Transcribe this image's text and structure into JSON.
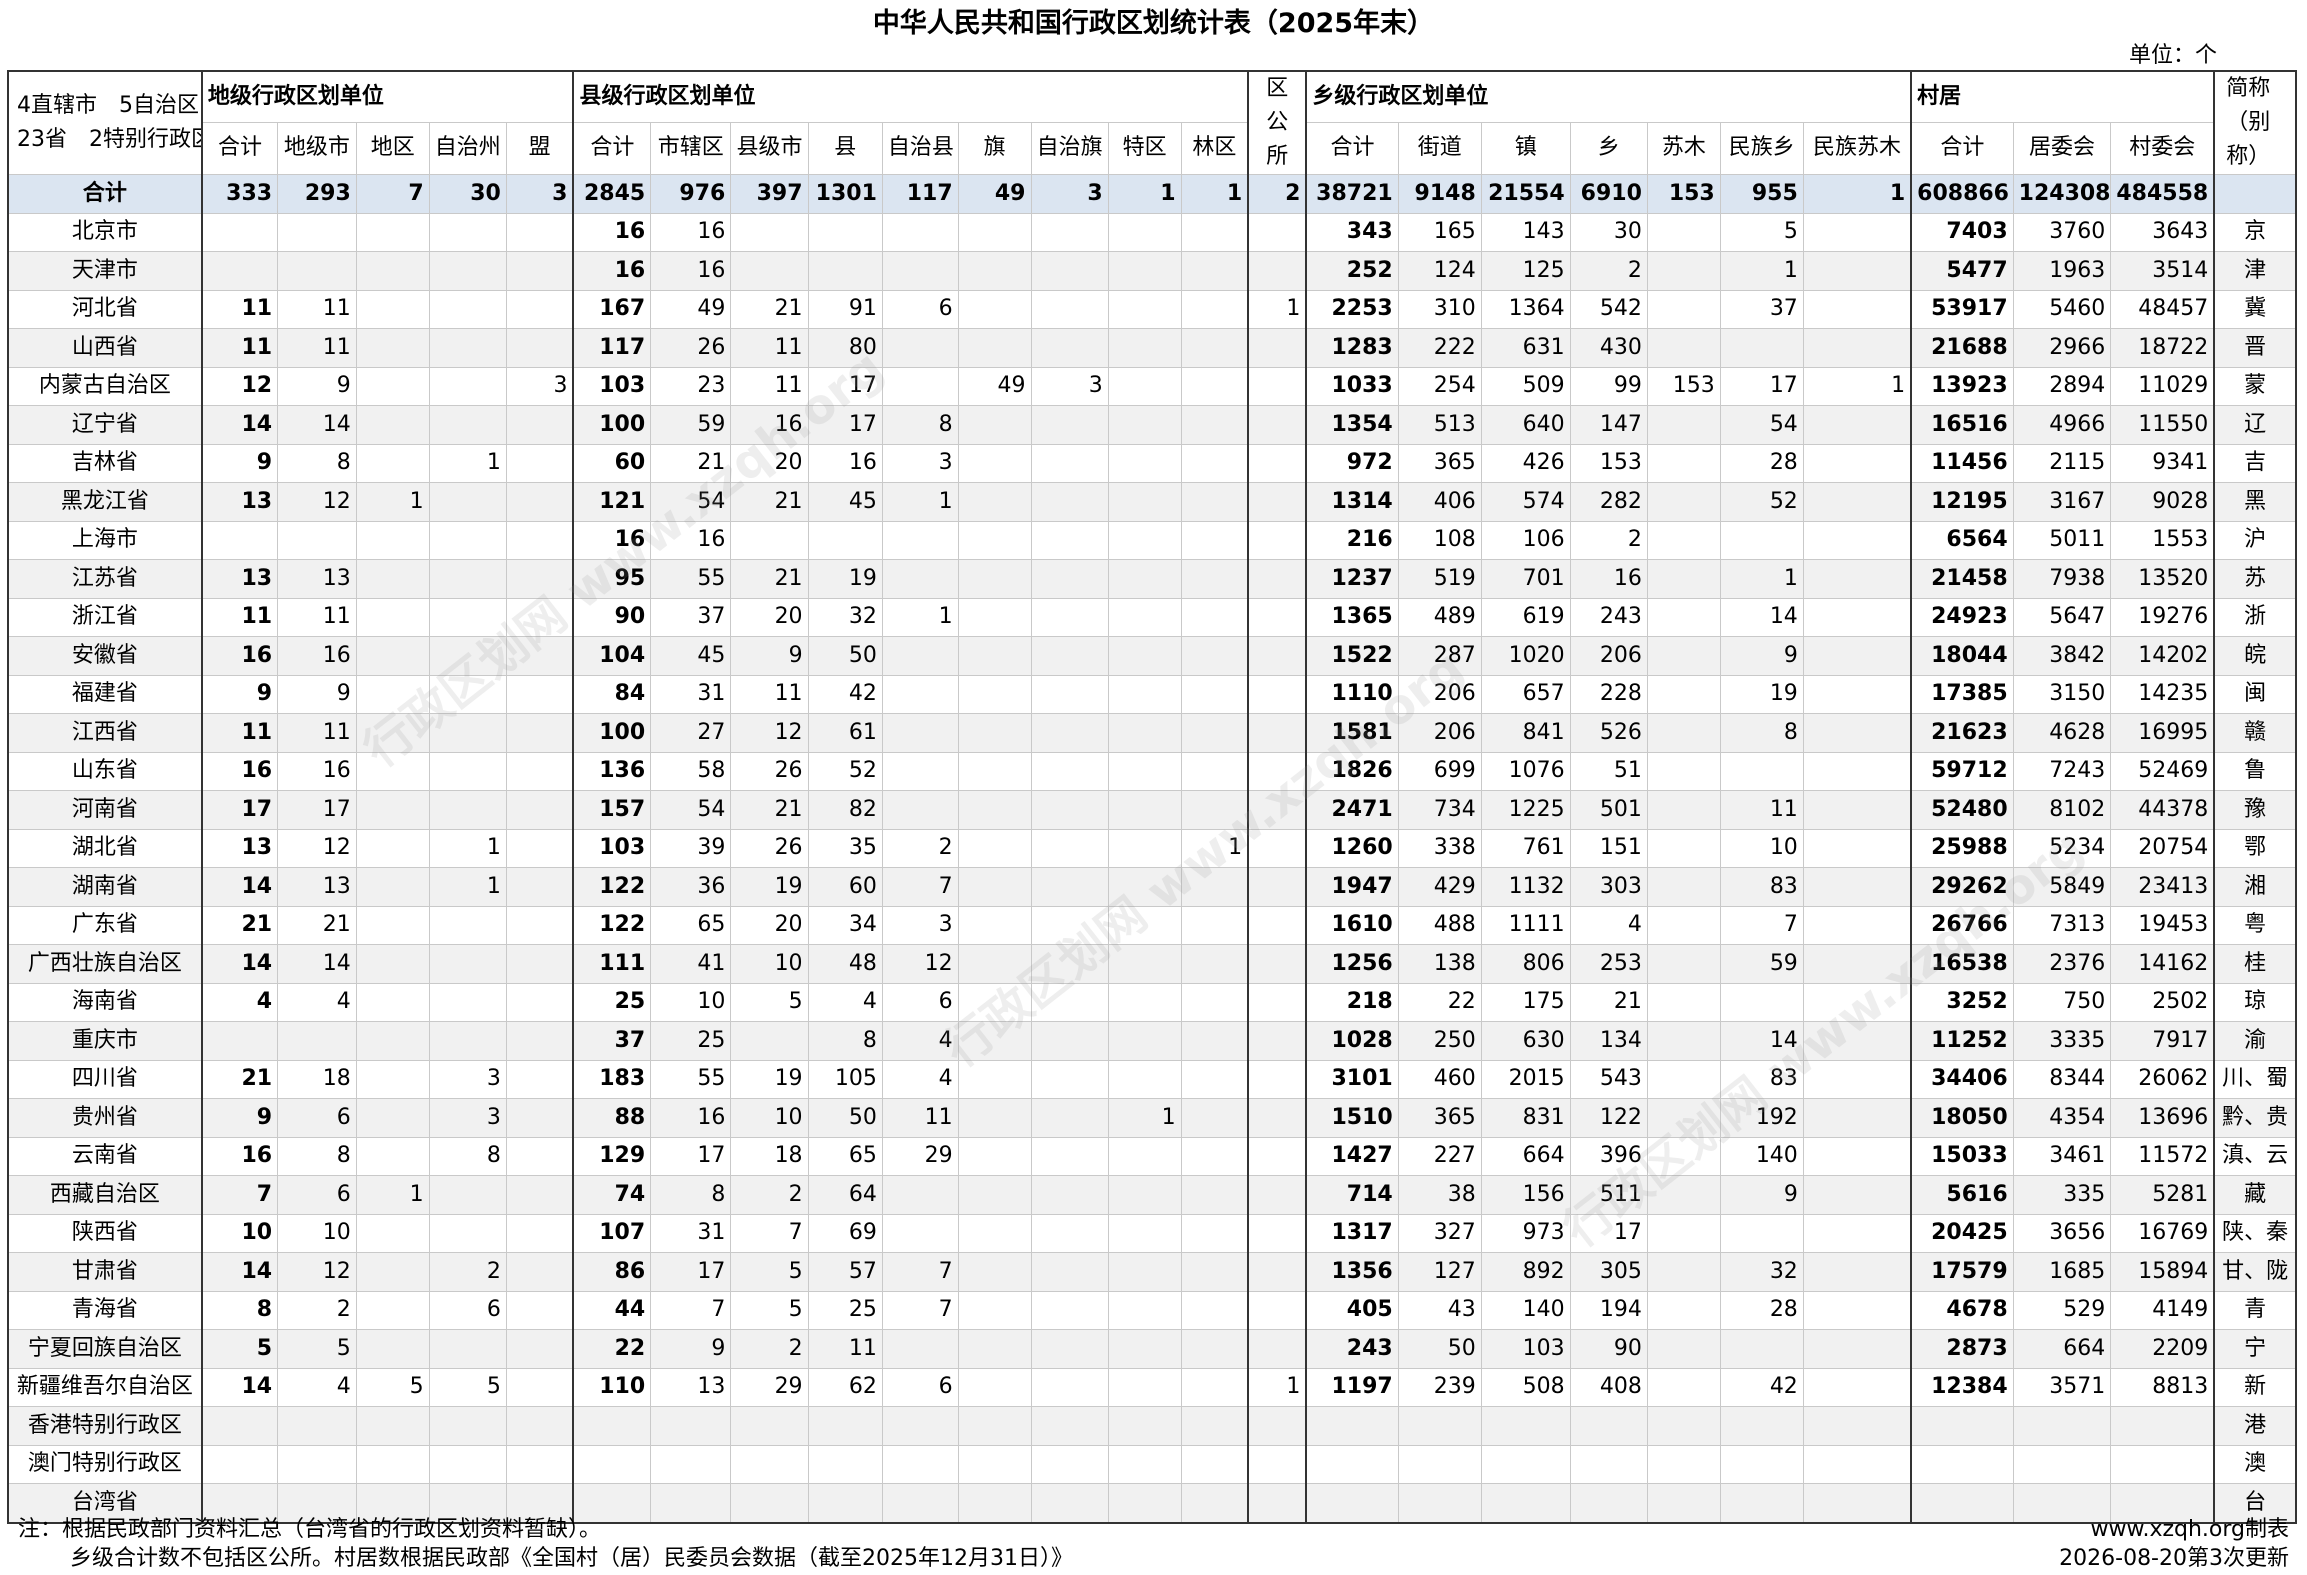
{
  "title": "中华人民共和国行政区划统计表（2025年末）",
  "unit": "单位：个",
  "corner": {
    "line1": "4直辖市　5自治区",
    "line2": "23省　2特别行政区"
  },
  "groups": {
    "prefecture": "地级行政区划单位",
    "county": "县级行政区划单位",
    "district_office": "区公所",
    "township": "乡级行政区划单位",
    "village": "村居",
    "abbr": "简称（别称）"
  },
  "subheaders": {
    "prefecture": [
      "合计",
      "地级市",
      "地区",
      "自治州",
      "盟"
    ],
    "county": [
      "合计",
      "市辖区",
      "县级市",
      "县",
      "自治县",
      "旗",
      "自治旗",
      "特区",
      "林区"
    ],
    "township": [
      "合计",
      "街道",
      "镇",
      "乡",
      "苏木",
      "民族乡",
      "民族苏木"
    ],
    "village": [
      "合计",
      "居委会",
      "村委会"
    ]
  },
  "rows": [
    {
      "name": "合计",
      "p": [
        "333",
        "293",
        "7",
        "30",
        "3"
      ],
      "c": [
        "2845",
        "976",
        "397",
        "1301",
        "117",
        "49",
        "3",
        "1",
        "1"
      ],
      "q": "2",
      "t": [
        "38721",
        "9148",
        "21554",
        "6910",
        "153",
        "955",
        "1"
      ],
      "v": [
        "608866",
        "124308",
        "484558"
      ],
      "abbr": ""
    },
    {
      "name": "北京市",
      "p": [
        "",
        "",
        "",
        "",
        ""
      ],
      "c": [
        "16",
        "16",
        "",
        "",
        "",
        "",
        "",
        "",
        ""
      ],
      "q": "",
      "t": [
        "343",
        "165",
        "143",
        "30",
        "",
        "5",
        ""
      ],
      "v": [
        "7403",
        "3760",
        "3643"
      ],
      "abbr": "京"
    },
    {
      "name": "天津市",
      "p": [
        "",
        "",
        "",
        "",
        ""
      ],
      "c": [
        "16",
        "16",
        "",
        "",
        "",
        "",
        "",
        "",
        ""
      ],
      "q": "",
      "t": [
        "252",
        "124",
        "125",
        "2",
        "",
        "1",
        ""
      ],
      "v": [
        "5477",
        "1963",
        "3514"
      ],
      "abbr": "津"
    },
    {
      "name": "河北省",
      "p": [
        "11",
        "11",
        "",
        "",
        ""
      ],
      "c": [
        "167",
        "49",
        "21",
        "91",
        "6",
        "",
        "",
        "",
        ""
      ],
      "q": "1",
      "t": [
        "2253",
        "310",
        "1364",
        "542",
        "",
        "37",
        ""
      ],
      "v": [
        "53917",
        "5460",
        "48457"
      ],
      "abbr": "冀"
    },
    {
      "name": "山西省",
      "p": [
        "11",
        "11",
        "",
        "",
        ""
      ],
      "c": [
        "117",
        "26",
        "11",
        "80",
        "",
        "",
        "",
        "",
        ""
      ],
      "q": "",
      "t": [
        "1283",
        "222",
        "631",
        "430",
        "",
        "",
        ""
      ],
      "v": [
        "21688",
        "2966",
        "18722"
      ],
      "abbr": "晋"
    },
    {
      "name": "内蒙古自治区",
      "p": [
        "12",
        "9",
        "",
        "",
        "3"
      ],
      "c": [
        "103",
        "23",
        "11",
        "17",
        "",
        "49",
        "3",
        "",
        ""
      ],
      "q": "",
      "t": [
        "1033",
        "254",
        "509",
        "99",
        "153",
        "17",
        "1"
      ],
      "v": [
        "13923",
        "2894",
        "11029"
      ],
      "abbr": "蒙"
    },
    {
      "name": "辽宁省",
      "p": [
        "14",
        "14",
        "",
        "",
        ""
      ],
      "c": [
        "100",
        "59",
        "16",
        "17",
        "8",
        "",
        "",
        "",
        ""
      ],
      "q": "",
      "t": [
        "1354",
        "513",
        "640",
        "147",
        "",
        "54",
        ""
      ],
      "v": [
        "16516",
        "4966",
        "11550"
      ],
      "abbr": "辽"
    },
    {
      "name": "吉林省",
      "p": [
        "9",
        "8",
        "",
        "1",
        ""
      ],
      "c": [
        "60",
        "21",
        "20",
        "16",
        "3",
        "",
        "",
        "",
        ""
      ],
      "q": "",
      "t": [
        "972",
        "365",
        "426",
        "153",
        "",
        "28",
        ""
      ],
      "v": [
        "11456",
        "2115",
        "9341"
      ],
      "abbr": "吉"
    },
    {
      "name": "黑龙江省",
      "p": [
        "13",
        "12",
        "1",
        "",
        ""
      ],
      "c": [
        "121",
        "54",
        "21",
        "45",
        "1",
        "",
        "",
        "",
        ""
      ],
      "q": "",
      "t": [
        "1314",
        "406",
        "574",
        "282",
        "",
        "52",
        ""
      ],
      "v": [
        "12195",
        "3167",
        "9028"
      ],
      "abbr": "黑"
    },
    {
      "name": "上海市",
      "p": [
        "",
        "",
        "",
        "",
        ""
      ],
      "c": [
        "16",
        "16",
        "",
        "",
        "",
        "",
        "",
        "",
        ""
      ],
      "q": "",
      "t": [
        "216",
        "108",
        "106",
        "2",
        "",
        "",
        ""
      ],
      "v": [
        "6564",
        "5011",
        "1553"
      ],
      "abbr": "沪"
    },
    {
      "name": "江苏省",
      "p": [
        "13",
        "13",
        "",
        "",
        ""
      ],
      "c": [
        "95",
        "55",
        "21",
        "19",
        "",
        "",
        "",
        "",
        ""
      ],
      "q": "",
      "t": [
        "1237",
        "519",
        "701",
        "16",
        "",
        "1",
        ""
      ],
      "v": [
        "21458",
        "7938",
        "13520"
      ],
      "abbr": "苏"
    },
    {
      "name": "浙江省",
      "p": [
        "11",
        "11",
        "",
        "",
        ""
      ],
      "c": [
        "90",
        "37",
        "20",
        "32",
        "1",
        "",
        "",
        "",
        ""
      ],
      "q": "",
      "t": [
        "1365",
        "489",
        "619",
        "243",
        "",
        "14",
        ""
      ],
      "v": [
        "24923",
        "5647",
        "19276"
      ],
      "abbr": "浙"
    },
    {
      "name": "安徽省",
      "p": [
        "16",
        "16",
        "",
        "",
        ""
      ],
      "c": [
        "104",
        "45",
        "9",
        "50",
        "",
        "",
        "",
        "",
        ""
      ],
      "q": "",
      "t": [
        "1522",
        "287",
        "1020",
        "206",
        "",
        "9",
        ""
      ],
      "v": [
        "18044",
        "3842",
        "14202"
      ],
      "abbr": "皖"
    },
    {
      "name": "福建省",
      "p": [
        "9",
        "9",
        "",
        "",
        ""
      ],
      "c": [
        "84",
        "31",
        "11",
        "42",
        "",
        "",
        "",
        "",
        ""
      ],
      "q": "",
      "t": [
        "1110",
        "206",
        "657",
        "228",
        "",
        "19",
        ""
      ],
      "v": [
        "17385",
        "3150",
        "14235"
      ],
      "abbr": "闽"
    },
    {
      "name": "江西省",
      "p": [
        "11",
        "11",
        "",
        "",
        ""
      ],
      "c": [
        "100",
        "27",
        "12",
        "61",
        "",
        "",
        "",
        "",
        ""
      ],
      "q": "",
      "t": [
        "1581",
        "206",
        "841",
        "526",
        "",
        "8",
        ""
      ],
      "v": [
        "21623",
        "4628",
        "16995"
      ],
      "abbr": "赣"
    },
    {
      "name": "山东省",
      "p": [
        "16",
        "16",
        "",
        "",
        ""
      ],
      "c": [
        "136",
        "58",
        "26",
        "52",
        "",
        "",
        "",
        "",
        ""
      ],
      "q": "",
      "t": [
        "1826",
        "699",
        "1076",
        "51",
        "",
        "",
        ""
      ],
      "v": [
        "59712",
        "7243",
        "52469"
      ],
      "abbr": "鲁"
    },
    {
      "name": "河南省",
      "p": [
        "17",
        "17",
        "",
        "",
        ""
      ],
      "c": [
        "157",
        "54",
        "21",
        "82",
        "",
        "",
        "",
        "",
        ""
      ],
      "q": "",
      "t": [
        "2471",
        "734",
        "1225",
        "501",
        "",
        "11",
        ""
      ],
      "v": [
        "52480",
        "8102",
        "44378"
      ],
      "abbr": "豫"
    },
    {
      "name": "湖北省",
      "p": [
        "13",
        "12",
        "",
        "1",
        ""
      ],
      "c": [
        "103",
        "39",
        "26",
        "35",
        "2",
        "",
        "",
        "",
        "1"
      ],
      "q": "",
      "t": [
        "1260",
        "338",
        "761",
        "151",
        "",
        "10",
        ""
      ],
      "v": [
        "25988",
        "5234",
        "20754"
      ],
      "abbr": "鄂"
    },
    {
      "name": "湖南省",
      "p": [
        "14",
        "13",
        "",
        "1",
        ""
      ],
      "c": [
        "122",
        "36",
        "19",
        "60",
        "7",
        "",
        "",
        "",
        ""
      ],
      "q": "",
      "t": [
        "1947",
        "429",
        "1132",
        "303",
        "",
        "83",
        ""
      ],
      "v": [
        "29262",
        "5849",
        "23413"
      ],
      "abbr": "湘"
    },
    {
      "name": "广东省",
      "p": [
        "21",
        "21",
        "",
        "",
        ""
      ],
      "c": [
        "122",
        "65",
        "20",
        "34",
        "3",
        "",
        "",
        "",
        ""
      ],
      "q": "",
      "t": [
        "1610",
        "488",
        "1111",
        "4",
        "",
        "7",
        ""
      ],
      "v": [
        "26766",
        "7313",
        "19453"
      ],
      "abbr": "粤"
    },
    {
      "name": "广西壮族自治区",
      "p": [
        "14",
        "14",
        "",
        "",
        ""
      ],
      "c": [
        "111",
        "41",
        "10",
        "48",
        "12",
        "",
        "",
        "",
        ""
      ],
      "q": "",
      "t": [
        "1256",
        "138",
        "806",
        "253",
        "",
        "59",
        ""
      ],
      "v": [
        "16538",
        "2376",
        "14162"
      ],
      "abbr": "桂"
    },
    {
      "name": "海南省",
      "p": [
        "4",
        "4",
        "",
        "",
        ""
      ],
      "c": [
        "25",
        "10",
        "5",
        "4",
        "6",
        "",
        "",
        "",
        ""
      ],
      "q": "",
      "t": [
        "218",
        "22",
        "175",
        "21",
        "",
        "",
        ""
      ],
      "v": [
        "3252",
        "750",
        "2502"
      ],
      "abbr": "琼"
    },
    {
      "name": "重庆市",
      "p": [
        "",
        "",
        "",
        "",
        ""
      ],
      "c": [
        "37",
        "25",
        "",
        "8",
        "4",
        "",
        "",
        "",
        ""
      ],
      "q": "",
      "t": [
        "1028",
        "250",
        "630",
        "134",
        "",
        "14",
        ""
      ],
      "v": [
        "11252",
        "3335",
        "7917"
      ],
      "abbr": "渝"
    },
    {
      "name": "四川省",
      "p": [
        "21",
        "18",
        "",
        "3",
        ""
      ],
      "c": [
        "183",
        "55",
        "19",
        "105",
        "4",
        "",
        "",
        "",
        ""
      ],
      "q": "",
      "t": [
        "3101",
        "460",
        "2015",
        "543",
        "",
        "83",
        ""
      ],
      "v": [
        "34406",
        "8344",
        "26062"
      ],
      "abbr": "川、蜀"
    },
    {
      "name": "贵州省",
      "p": [
        "9",
        "6",
        "",
        "3",
        ""
      ],
      "c": [
        "88",
        "16",
        "10",
        "50",
        "11",
        "",
        "",
        "1",
        ""
      ],
      "q": "",
      "t": [
        "1510",
        "365",
        "831",
        "122",
        "",
        "192",
        ""
      ],
      "v": [
        "18050",
        "4354",
        "13696"
      ],
      "abbr": "黔、贵"
    },
    {
      "name": "云南省",
      "p": [
        "16",
        "8",
        "",
        "8",
        ""
      ],
      "c": [
        "129",
        "17",
        "18",
        "65",
        "29",
        "",
        "",
        "",
        ""
      ],
      "q": "",
      "t": [
        "1427",
        "227",
        "664",
        "396",
        "",
        "140",
        ""
      ],
      "v": [
        "15033",
        "3461",
        "11572"
      ],
      "abbr": "滇、云"
    },
    {
      "name": "西藏自治区",
      "p": [
        "7",
        "6",
        "1",
        "",
        ""
      ],
      "c": [
        "74",
        "8",
        "2",
        "64",
        "",
        "",
        "",
        "",
        ""
      ],
      "q": "",
      "t": [
        "714",
        "38",
        "156",
        "511",
        "",
        "9",
        ""
      ],
      "v": [
        "5616",
        "335",
        "5281"
      ],
      "abbr": "藏"
    },
    {
      "name": "陕西省",
      "p": [
        "10",
        "10",
        "",
        "",
        ""
      ],
      "c": [
        "107",
        "31",
        "7",
        "69",
        "",
        "",
        "",
        "",
        ""
      ],
      "q": "",
      "t": [
        "1317",
        "327",
        "973",
        "17",
        "",
        "",
        ""
      ],
      "v": [
        "20425",
        "3656",
        "16769"
      ],
      "abbr": "陕、秦"
    },
    {
      "name": "甘肃省",
      "p": [
        "14",
        "12",
        "",
        "2",
        ""
      ],
      "c": [
        "86",
        "17",
        "5",
        "57",
        "7",
        "",
        "",
        "",
        ""
      ],
      "q": "",
      "t": [
        "1356",
        "127",
        "892",
        "305",
        "",
        "32",
        ""
      ],
      "v": [
        "17579",
        "1685",
        "15894"
      ],
      "abbr": "甘、陇"
    },
    {
      "name": "青海省",
      "p": [
        "8",
        "2",
        "",
        "6",
        ""
      ],
      "c": [
        "44",
        "7",
        "5",
        "25",
        "7",
        "",
        "",
        "",
        ""
      ],
      "q": "",
      "t": [
        "405",
        "43",
        "140",
        "194",
        "",
        "28",
        ""
      ],
      "v": [
        "4678",
        "529",
        "4149"
      ],
      "abbr": "青"
    },
    {
      "name": "宁夏回族自治区",
      "p": [
        "5",
        "5",
        "",
        "",
        ""
      ],
      "c": [
        "22",
        "9",
        "2",
        "11",
        "",
        "",
        "",
        "",
        ""
      ],
      "q": "",
      "t": [
        "243",
        "50",
        "103",
        "90",
        "",
        "",
        ""
      ],
      "v": [
        "2873",
        "664",
        "2209"
      ],
      "abbr": "宁"
    },
    {
      "name": "新疆维吾尔自治区",
      "p": [
        "14",
        "4",
        "5",
        "5",
        ""
      ],
      "c": [
        "110",
        "13",
        "29",
        "62",
        "6",
        "",
        "",
        "",
        ""
      ],
      "q": "1",
      "t": [
        "1197",
        "239",
        "508",
        "408",
        "",
        "42",
        ""
      ],
      "v": [
        "12384",
        "3571",
        "8813"
      ],
      "abbr": "新"
    },
    {
      "name": "香港特别行政区",
      "p": [
        "",
        "",
        "",
        "",
        ""
      ],
      "c": [
        "",
        "",
        "",
        "",
        "",
        "",
        "",
        "",
        ""
      ],
      "q": "",
      "t": [
        "",
        "",
        "",
        "",
        "",
        "",
        ""
      ],
      "v": [
        "",
        "",
        ""
      ],
      "abbr": "港"
    },
    {
      "name": "澳门特别行政区",
      "p": [
        "",
        "",
        "",
        "",
        ""
      ],
      "c": [
        "",
        "",
        "",
        "",
        "",
        "",
        "",
        "",
        ""
      ],
      "q": "",
      "t": [
        "",
        "",
        "",
        "",
        "",
        "",
        ""
      ],
      "v": [
        "",
        "",
        ""
      ],
      "abbr": "澳"
    },
    {
      "name": "台湾省",
      "p": [
        "",
        "",
        "",
        "",
        ""
      ],
      "c": [
        "",
        "",
        "",
        "",
        "",
        "",
        "",
        "",
        ""
      ],
      "q": "",
      "t": [
        "",
        "",
        "",
        "",
        "",
        "",
        ""
      ],
      "v": [
        "",
        "",
        ""
      ],
      "abbr": "台"
    }
  ],
  "notes": {
    "line1": "注：根据民政部门资料汇总（台湾省的行政区划资料暂缺）。",
    "line2": "乡级合计数不包括区公所。村居数根据民政部《全国村（居）民委员会数据（截至2025年12月31日）》",
    "maker": "www.xzqh.org制表",
    "updated": "2026-08-20第3次更新"
  },
  "watermark": [
    "行政区划网 www.xzqh.org",
    "行政区划网 www.xzqh.org",
    "行政区划网 www.xzqh.org"
  ],
  "colors": {
    "total_row": "#dbe5f1",
    "alt_row": "#f1f1f1",
    "border": "#c9c9c9"
  }
}
